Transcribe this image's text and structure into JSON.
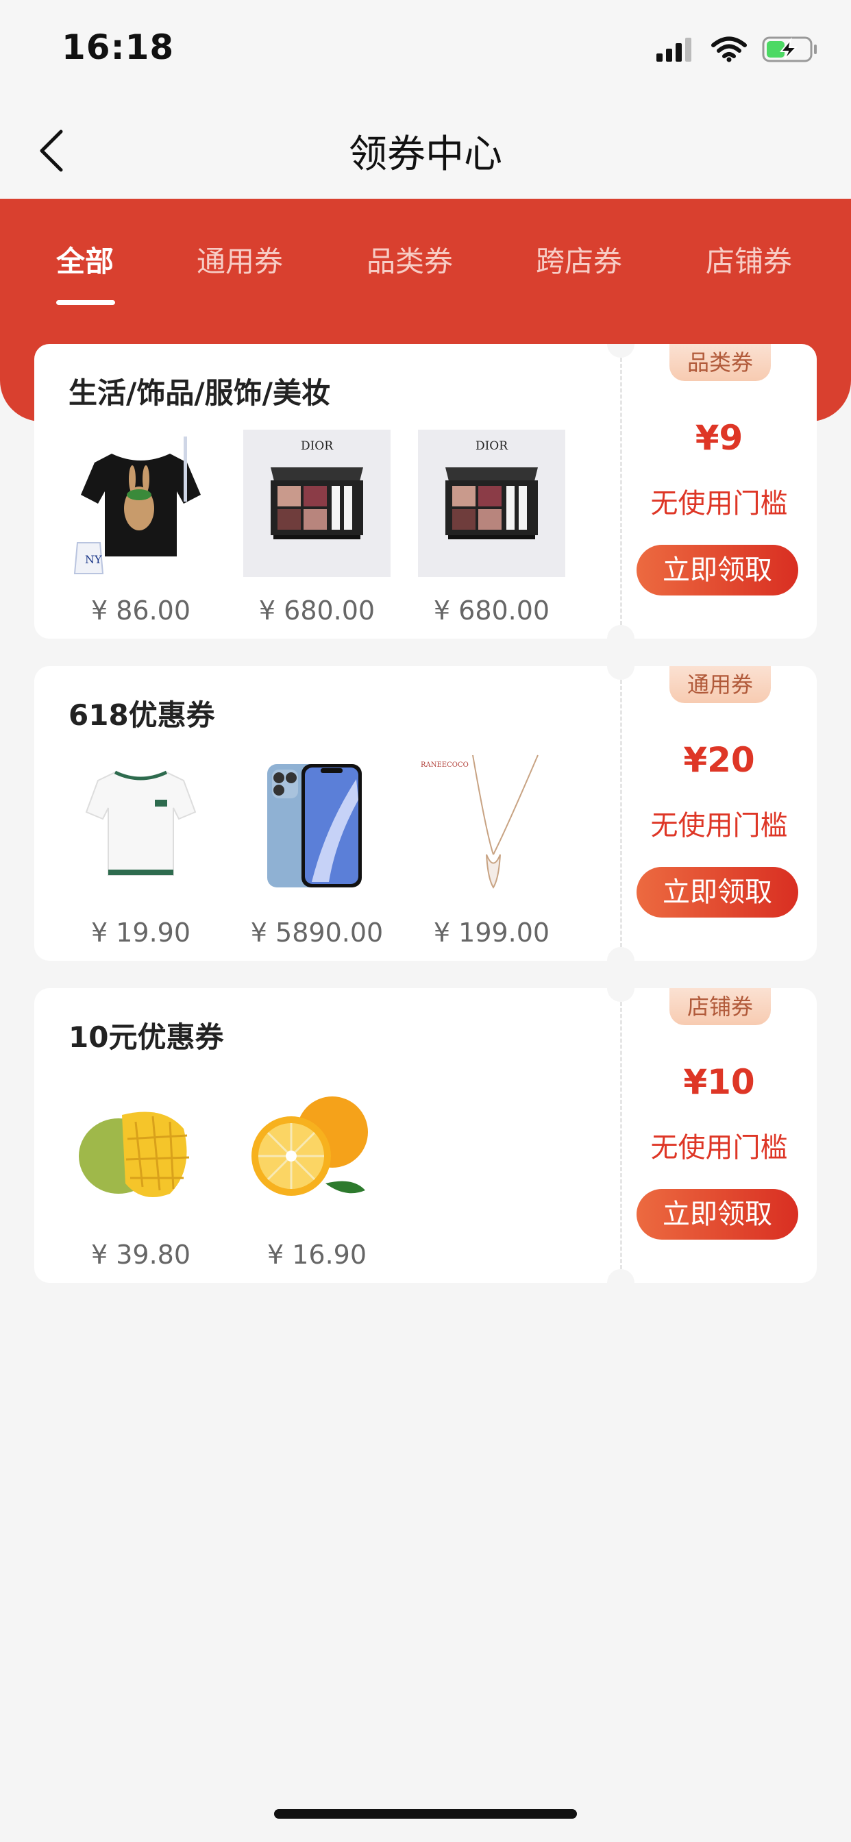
{
  "status_bar": {
    "time": "16:18"
  },
  "nav": {
    "title": "领券中心"
  },
  "tabs": [
    {
      "label": "全部",
      "active": true
    },
    {
      "label": "通用券",
      "active": false
    },
    {
      "label": "品类券",
      "active": false
    },
    {
      "label": "跨店券",
      "active": false
    },
    {
      "label": "店铺券",
      "active": false
    }
  ],
  "coupons": [
    {
      "title": "生活/饰品/服饰/美妆",
      "badge": "品类券",
      "amount": "¥9",
      "threshold": "无使用门槛",
      "button": "立即领取",
      "products": [
        {
          "image": "black-tshirt",
          "price": "¥ 86.00"
        },
        {
          "image": "dior-eyeshadow-palette",
          "price": "¥ 680.00",
          "brand": "DIOR"
        },
        {
          "image": "dior-eyeshadow-palette",
          "price": "¥ 680.00",
          "brand": "DIOR"
        }
      ]
    },
    {
      "title": "618优惠券",
      "badge": "通用券",
      "amount": "¥20",
      "threshold": "无使用门槛",
      "button": "立即领取",
      "products": [
        {
          "image": "white-tshirt",
          "price": "¥ 19.90"
        },
        {
          "image": "blue-smartphone",
          "price": "¥ 5890.00"
        },
        {
          "image": "whale-tail-necklace",
          "price": "¥ 199.00",
          "brand": "RANEECOCO"
        }
      ]
    },
    {
      "title": "10元优惠券",
      "badge": "店铺券",
      "amount": "¥10",
      "threshold": "无使用门槛",
      "button": "立即领取",
      "products": [
        {
          "image": "mango",
          "price": "¥ 39.80"
        },
        {
          "image": "orange",
          "price": "¥ 16.90"
        }
      ]
    }
  ],
  "colors": {
    "header_red": "#d9402f",
    "price_red": "#de3626",
    "button_gradient_start": "#ec6a40",
    "button_gradient_end": "#d92f22",
    "badge_bg": "#f9d6c1",
    "page_bg": "#f5f5f5"
  }
}
